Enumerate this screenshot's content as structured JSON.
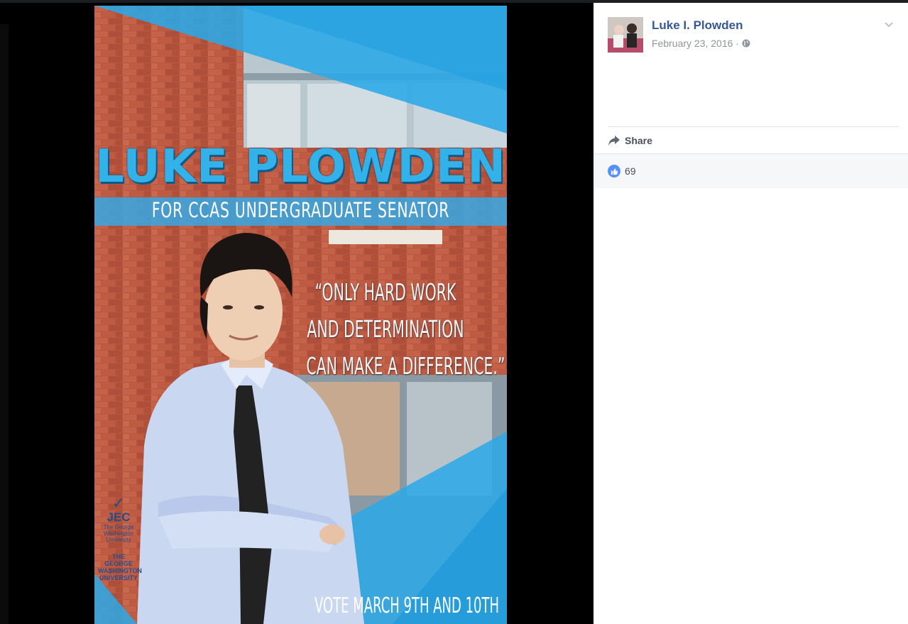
{
  "poster": {
    "name": "LUKE PLOWDEN",
    "subtitle": "FOR CCAS UNDERGRADUATE SENATOR",
    "quote_lines": [
      "“ONLY HARD WORK",
      "AND DETERMINATION",
      "CAN MAKE A DIFFERENCE.”"
    ],
    "vote": "VOTE MARCH 9TH AND 10TH",
    "jec": {
      "check": "✓",
      "abbr": "JEC",
      "line1": "The George",
      "line2": "Washington",
      "line3": "University",
      "gw1": "THE GEORGE",
      "gw2": "WASHINGTON",
      "gw3": "UNIVERSITY"
    }
  },
  "post": {
    "author": "Luke I. Plowden",
    "date": "February 23, 2016",
    "separator": "·",
    "privacy_icon": "globe-icon",
    "menu_icon": "chevron-down-icon",
    "share_label": "Share",
    "like_count": "69"
  },
  "colors": {
    "accent_blue": "#33b2ea",
    "author_link": "#365899",
    "like_blue": "#5890ff"
  }
}
